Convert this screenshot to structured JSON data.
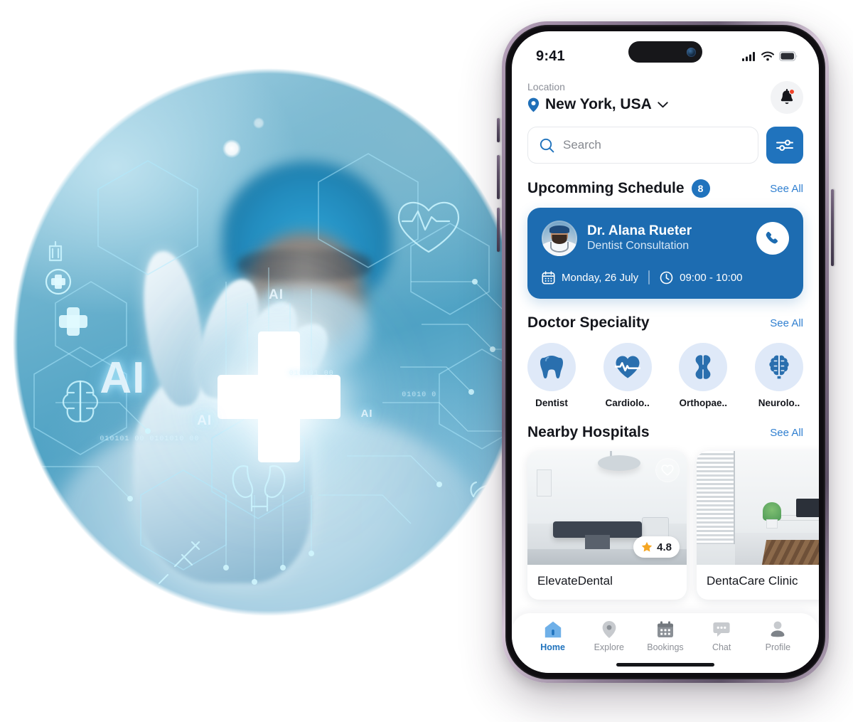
{
  "hero": {
    "alt": "medical-ai-doctor-touching-virtual-interface",
    "ai_label_large": "AI",
    "ai_label_mid_1": "AI",
    "ai_label_mid_2": "AI",
    "ai_label_small": "AI",
    "binary_1": "010101 00 0101010 00",
    "binary_2": "010101 00",
    "binary_3": "01010 0"
  },
  "phone": {
    "statusbar": {
      "time": "9:41",
      "signal_icon": "cellular-bars-icon",
      "wifi_icon": "wifi-icon",
      "battery_icon": "battery-icon"
    },
    "header": {
      "location_label": "Location",
      "location_value": "New York, USA",
      "location_pin_icon": "map-pin-icon",
      "location_chevron_icon": "chevron-down-icon",
      "notification_icon": "bell-icon",
      "notification_has_badge": true
    },
    "search": {
      "placeholder": "Search",
      "search_icon": "search-icon",
      "filter_icon": "sliders-icon",
      "filter_color": "#2073bd"
    },
    "schedule": {
      "title": "Upcomming Schedule",
      "count": "8",
      "see_all": "See All",
      "card": {
        "doctor_name": "Dr. Alana Rueter",
        "specialty": "Dentist Consultation",
        "avatar_icon": "doctor-avatar",
        "call_icon": "phone-icon",
        "calendar_icon": "calendar-icon",
        "date": "Monday, 26 July",
        "clock_icon": "clock-icon",
        "time": "09:00 - 10:00",
        "card_color": "#1d6cb1"
      }
    },
    "speciality": {
      "title": "Doctor Speciality",
      "see_all": "See All",
      "items": [
        {
          "label": "Dentist",
          "icon": "tooth-icon"
        },
        {
          "label": "Cardiolo..",
          "icon": "heart-pulse-icon"
        },
        {
          "label": "Orthopae..",
          "icon": "bone-joint-icon"
        },
        {
          "label": "Neurolo..",
          "icon": "brain-icon"
        }
      ]
    },
    "hospitals": {
      "title": "Nearby Hospitals",
      "see_all": "See All",
      "items": [
        {
          "name": "ElevateDental",
          "rating": "4.8",
          "star_icon": "star-icon",
          "heart_icon": "heart-outline-icon",
          "image": "operating-room-photo"
        },
        {
          "name": "DentaCare Clinic",
          "image": "clinic-office-photo"
        }
      ]
    },
    "tabbar": {
      "items": [
        {
          "label": "Home",
          "icon": "home-icon",
          "active": true
        },
        {
          "label": "Explore",
          "icon": "explore-pin-icon",
          "active": false
        },
        {
          "label": "Bookings",
          "icon": "calendar-icon",
          "active": false
        },
        {
          "label": "Chat",
          "icon": "chat-bubble-icon",
          "active": false
        },
        {
          "label": "Profile",
          "icon": "person-icon",
          "active": false
        }
      ],
      "active_color": "#2073bd",
      "inactive_color": "#b8bcc2"
    }
  }
}
